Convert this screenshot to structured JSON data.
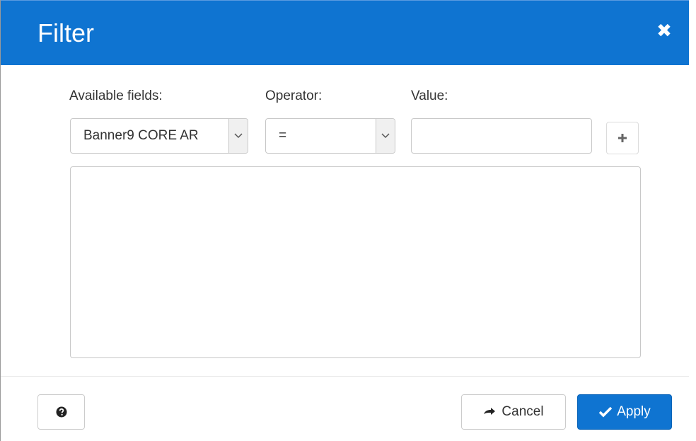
{
  "dialog": {
    "title": "Filter",
    "close_icon": "close-icon"
  },
  "labels": {
    "available_fields": "Available fields:",
    "operator": "Operator:",
    "value": "Value:"
  },
  "fields": {
    "available_field_selected": "Banner9 CORE AR",
    "operator_selected": "=",
    "value_input": ""
  },
  "buttons": {
    "add_icon": "plus-icon",
    "help_icon": "question-circle-icon",
    "cancel_label": "Cancel",
    "cancel_icon": "arrow-right-icon",
    "apply_label": "Apply",
    "apply_icon": "check-icon"
  },
  "colors": {
    "header_bg": "#0f74d1",
    "apply_bg": "#0f74d1"
  }
}
